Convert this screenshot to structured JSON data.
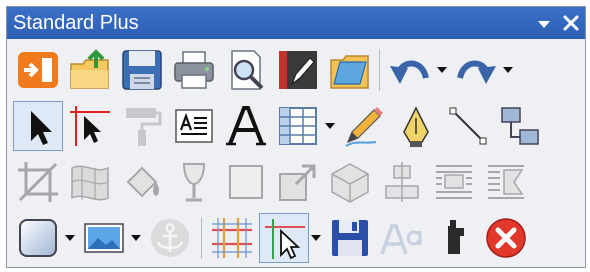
{
  "toolbar": {
    "title": "Standard Plus",
    "menu_dropdown_icon": "triangle-down-icon",
    "close_icon": "close-x-icon"
  },
  "rows": [
    {
      "name": "file-row",
      "items": [
        "import-icon",
        "open-folder-icon",
        "save-icon",
        "print-icon",
        "print-preview-icon",
        "edit-book-icon",
        "folder-icon",
        "undo-icon",
        "redo-icon"
      ]
    },
    {
      "name": "tools-row",
      "items": [
        "pointer-icon",
        "frame-pointer-icon",
        "format-paint-icon",
        "text-frame-icon",
        "text-icon",
        "table-icon",
        "pencil-icon",
        "pen-nib-icon",
        "line-icon",
        "link-frames-icon"
      ]
    },
    {
      "name": "object-row",
      "items": [
        "crop-icon",
        "warp-icon",
        "fill-bucket-icon",
        "wine-glass-icon",
        "rectangle-icon",
        "resize-icon",
        "3d-cube-icon",
        "align-icon",
        "wrap-text-icon",
        "wrap-sides-icon"
      ]
    },
    {
      "name": "misc-row",
      "items": [
        "shape-icon",
        "picture-icon",
        "anchor-icon",
        "grid-icon",
        "select-grid-icon",
        "save-disk-icon",
        "font-size-icon",
        "hand-icon",
        "stop-icon"
      ]
    }
  ],
  "colors": {
    "title_bar": "#2d5fb4",
    "accent_orange": "#f07a1c",
    "stop_red": "#e2372b",
    "save_blue": "#2b4fa8"
  }
}
